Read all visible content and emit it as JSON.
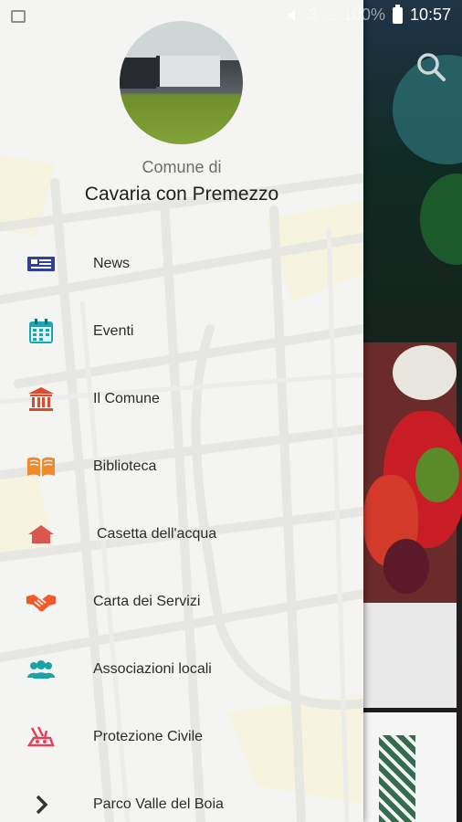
{
  "status_bar": {
    "battery_text": "100%",
    "time": "10:57",
    "signal_text": "3 ..."
  },
  "drawer": {
    "subtitle": "Comune di",
    "title": "Cavaria con Premezzo",
    "menu": [
      {
        "label": "News",
        "icon": "newspaper-icon",
        "color": "#2f3f9e"
      },
      {
        "label": "Eventi",
        "icon": "calendar-icon",
        "color": "#1aa7b5"
      },
      {
        "label": "Il Comune",
        "icon": "townhall-icon",
        "color": "#e04a2b"
      },
      {
        "label": "Biblioteca",
        "icon": "book-icon",
        "color": "#f08a2a"
      },
      {
        "label": "Casetta dell'acqua",
        "icon": "house-icon",
        "color": "#d9574e"
      },
      {
        "label": "Carta dei Servizi",
        "icon": "handshake-icon",
        "color": "#f05a2a"
      },
      {
        "label": "Associazioni locali",
        "icon": "group-icon",
        "color": "#19a3a5"
      },
      {
        "label": "Protezione Civile",
        "icon": "rescue-icon",
        "color": "#e8405a"
      },
      {
        "label": "Parco Valle del Boia",
        "icon": "chevron-right-icon",
        "color": "#333333"
      }
    ]
  }
}
